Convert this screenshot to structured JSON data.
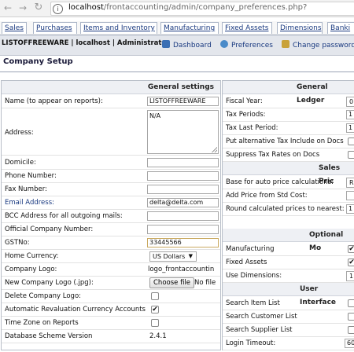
{
  "browser": {
    "url_host": "localhost",
    "url_path": "/frontaccounting/admin/company_preferences.php?"
  },
  "menu": {
    "tabs": [
      "Sales",
      "Purchases",
      "Items and Inventory",
      "Manufacturing",
      "Fixed Assets",
      "Dimensions",
      "Banki"
    ]
  },
  "header": {
    "user_info": "LISTOFFREEWARE | localhost | Administrator",
    "links": {
      "dashboard": "Dashboard",
      "preferences": "Preferences",
      "change_password": "Change password"
    }
  },
  "page": {
    "title": "Company Setup"
  },
  "general": {
    "heading": "General settings",
    "name_label": "Name (to appear on reports):",
    "name_value": "LISTOFFREEWARE",
    "address_label": "Address:",
    "address_value": "N/A",
    "domicile_label": "Domicile:",
    "domicile_value": "",
    "phone_label": "Phone Number:",
    "phone_value": "",
    "fax_label": "Fax Number:",
    "fax_value": "",
    "email_label": "Email Address:",
    "email_value": "delta@delta.com",
    "bcc_label": "BCC Address for all outgoing mails:",
    "bcc_value": "",
    "official_label": "Official Company Number:",
    "official_value": "",
    "gst_label": "GSTNo:",
    "gst_value": "33445566",
    "currency_label": "Home Currency:",
    "currency_value": "US Dollars",
    "logo_label": "Company Logo:",
    "logo_value": "logo_frontaccountin",
    "new_logo_label": "New Company Logo (.jpg):",
    "choose_file": "Choose file",
    "no_file": "No file",
    "delete_logo_label": "Delete Company Logo:",
    "auto_reval_label": "Automatic Revaluation Currency Accounts",
    "timezone_label": "Time Zone on Reports",
    "db_version_label": "Database Scheme Version",
    "db_version_value": "2.4.1"
  },
  "ledger": {
    "heading": "General Ledger",
    "fiscal_label": "Fiscal Year:",
    "fiscal_value": "0",
    "tax_periods_label": "Tax Periods:",
    "tax_periods_value": "1",
    "tax_last_label": "Tax Last Period:",
    "tax_last_value": "1",
    "alt_tax_label": "Put alternative Tax Include on Docs",
    "suppress_label": "Suppress Tax Rates on Docs"
  },
  "sales_pricing": {
    "heading": "Sales Pric",
    "base_label": "Base for auto price calculations:",
    "base_value": "R",
    "std_cost_label": "Add Price from Std Cost:",
    "round_label": "Round calculated prices to nearest:",
    "round_value": "1"
  },
  "optional": {
    "heading": "Optional Mo",
    "manufacturing_label": "Manufacturing",
    "fixed_assets_label": "Fixed Assets",
    "dimensions_label": "Use Dimensions:",
    "dimensions_value": "1"
  },
  "user_interface": {
    "heading": "User Interface",
    "item_list_label": "Search Item List",
    "customer_list_label": "Search Customer List",
    "supplier_list_label": "Search Supplier List",
    "login_timeout_label": "Login Timeout:",
    "login_timeout_value": "60"
  },
  "colors": {
    "link": "#1a3a80",
    "header_bg": "#e3e6ec",
    "section_bg": "#eef0f4",
    "focus_border": "#c9a960"
  }
}
